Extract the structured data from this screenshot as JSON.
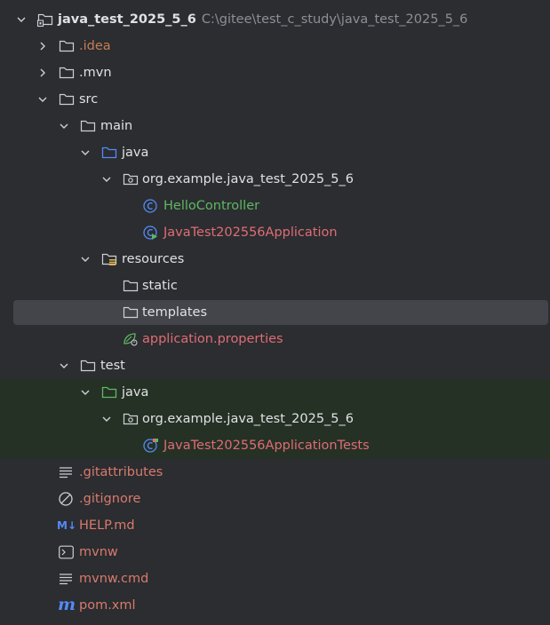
{
  "project": {
    "name": "java_test_2025_5_6",
    "path": "C:\\gitee\\test_c_study\\java_test_2025_5_6"
  },
  "tree": {
    "idea": ".idea",
    "mvn": ".mvn",
    "src": "src",
    "main": "main",
    "main_java": "java",
    "main_package": "org.example.java_test_2025_5_6",
    "hello_controller": "HelloController",
    "application_class": "JavaTest202556Application",
    "resources": "resources",
    "static": "static",
    "templates": "templates",
    "application_properties": "application.properties",
    "test": "test",
    "test_java": "java",
    "test_package": "org.example.java_test_2025_5_6",
    "tests_class": "JavaTest202556ApplicationTests",
    "gitattributes": ".gitattributes",
    "gitignore": ".gitignore",
    "help_md": "HELP.md",
    "mvnw": "mvnw",
    "mvnw_cmd": "mvnw.cmd",
    "pom_xml": "pom.xml"
  },
  "icons": {
    "help_md_badge": "M↓",
    "pom_badge": "m"
  },
  "colors": {
    "background": "#2b2d30",
    "selection": "#43454a",
    "test_source_bg": "#253125",
    "excluded_orange": "#c77d55",
    "class_green": "#5fb864",
    "modified_red": "#e06c75",
    "java_blue": "#548af7",
    "test_green": "#5fb864"
  }
}
